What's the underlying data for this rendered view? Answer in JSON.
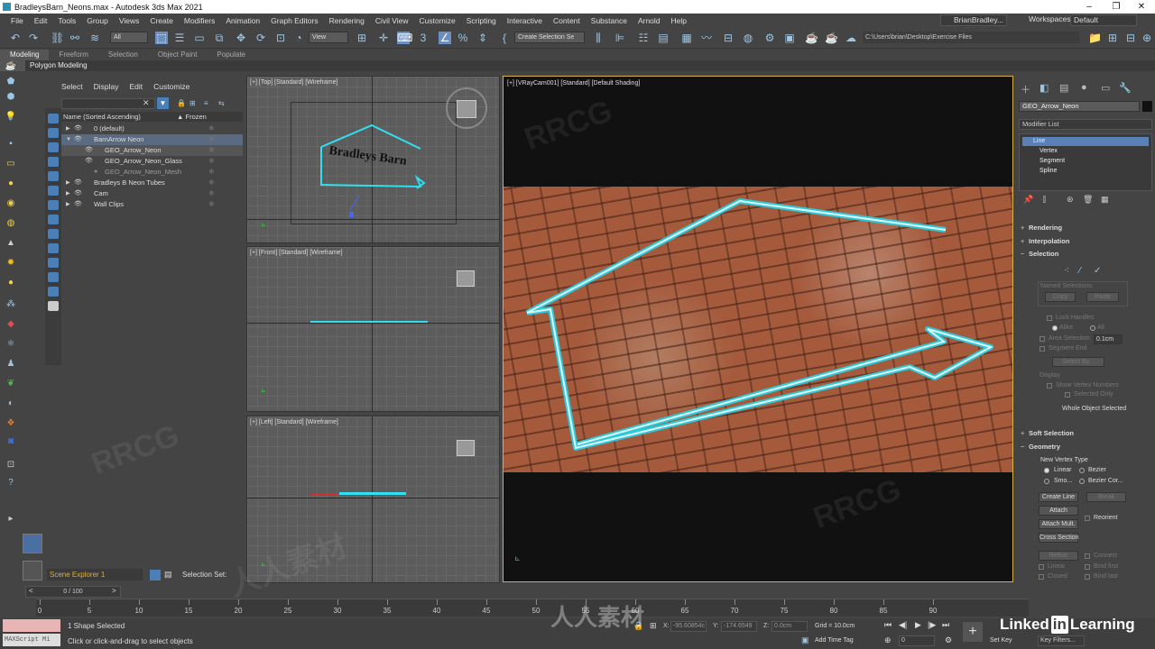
{
  "window": {
    "title": "BradleysBarn_Neons.max - Autodesk 3ds Max 2021"
  },
  "menu": [
    "File",
    "Edit",
    "Tools",
    "Group",
    "Views",
    "Create",
    "Modifiers",
    "Animation",
    "Graph Editors",
    "Rendering",
    "Civil View",
    "Customize",
    "Scripting",
    "Interactive",
    "Content",
    "Substance",
    "Arnold",
    "Help"
  ],
  "account": {
    "user": "BrianBradley...",
    "workspaces_label": "Workspaces:",
    "workspace": "Default"
  },
  "toolbar": {
    "filter": "All",
    "view": "View",
    "selection_set": "Create Selection Se",
    "project_path": "C:\\Users\\brian\\Desktop\\Exercise Files"
  },
  "ribbon": {
    "tabs": [
      "Modeling",
      "Freeform",
      "Selection",
      "Object Paint",
      "Populate"
    ],
    "active": "Modeling",
    "sub": "Polygon Modeling"
  },
  "explorer": {
    "menu": [
      "Select",
      "Display",
      "Edit",
      "Customize"
    ],
    "col_name": "Name (Sorted Ascending)",
    "col_frozen": "▲ Frozen",
    "rows": [
      "0 (default)",
      "BarnArrow Neon",
      "GEO_Arrow_Neon",
      "GEO_Arrow_Neon_Glass",
      "GEO_Arrow_Neon_Mesh",
      "Bradleys B Neon Tubes",
      "Cam",
      "Wall Clips"
    ],
    "footer_dropdown": "Scene Explorer 1",
    "selection_set_label": "Selection Set:"
  },
  "viewports": {
    "top": "[+] [Top] [Standard] [Wireframe]",
    "front": "[+] [Front] [Standard] [Wireframe]",
    "left": "[+] [Left] [Standard] [Wireframe]",
    "camera": "[+] [VRayCam001] [Standard] [Default Shading]",
    "sign_text": "Bradleys Barn"
  },
  "command_panel": {
    "object_name": "GEO_Arrow_Neon",
    "modifier_list": "Modifier List",
    "stack": [
      "Line",
      "Vertex",
      "Segment",
      "Spline"
    ],
    "rollouts": {
      "rendering": "Rendering",
      "interpolation": "Interpolation",
      "selection": "Selection",
      "soft_selection": "Soft Selection",
      "geometry": "Geometry"
    },
    "named_selections": "Named Selections:",
    "copy": "Copy",
    "paste": "Paste",
    "lock_handles": "Lock Handles",
    "alike": "Alike",
    "all": "All",
    "area_selection": "Area Selection:",
    "area_value": "0.1cm",
    "segment_end": "Segment End",
    "select_by": "Select By...",
    "display": "Display",
    "show_vertex_numbers": "Show Vertex Numbers",
    "selected_only": "Selected Only",
    "whole_object_selected": "Whole Object Selected",
    "new_vertex_type": "New Vertex Type",
    "linear": "Linear",
    "bezier": "Bezier",
    "smooth": "Smo...",
    "bezier_corner": "Bezier Cor...",
    "create_line": "Create Line",
    "break": "Break",
    "attach": "Attach",
    "reorient": "Reorient",
    "attach_mult": "Attach Mult.",
    "cross_section": "Cross Section",
    "refine": "Refine",
    "connect": "Connect",
    "linear2": "Linear",
    "bind_first": "Bind first",
    "closed": "Closed",
    "bind_last": "Bind last"
  },
  "timeline": {
    "frame": "0 / 100",
    "ticks": [
      "0",
      "5",
      "10",
      "15",
      "20",
      "25",
      "30",
      "35",
      "40",
      "45",
      "50",
      "55",
      "60",
      "65",
      "70",
      "75",
      "80",
      "85",
      "90"
    ]
  },
  "status": {
    "maxscript": "MAXScript Mi",
    "selected": "1 Shape Selected",
    "prompt": "Click or click-and-drag to select objects",
    "x_label": "X:",
    "x": "-95.60854c",
    "y_label": "Y:",
    "y": "-174.6549",
    "z_label": "Z:",
    "z": "0.0cm",
    "grid": "Grid = 10.0cm",
    "add_time_tag": "Add Time Tag",
    "set_key": "Set Key",
    "key_filters": "Key Filters...",
    "frame_value": "0"
  },
  "watermark": {
    "left": "Linked",
    "in": "in",
    "right": "Learning",
    "brand": "RRCG",
    "chinese": "人人素材"
  }
}
